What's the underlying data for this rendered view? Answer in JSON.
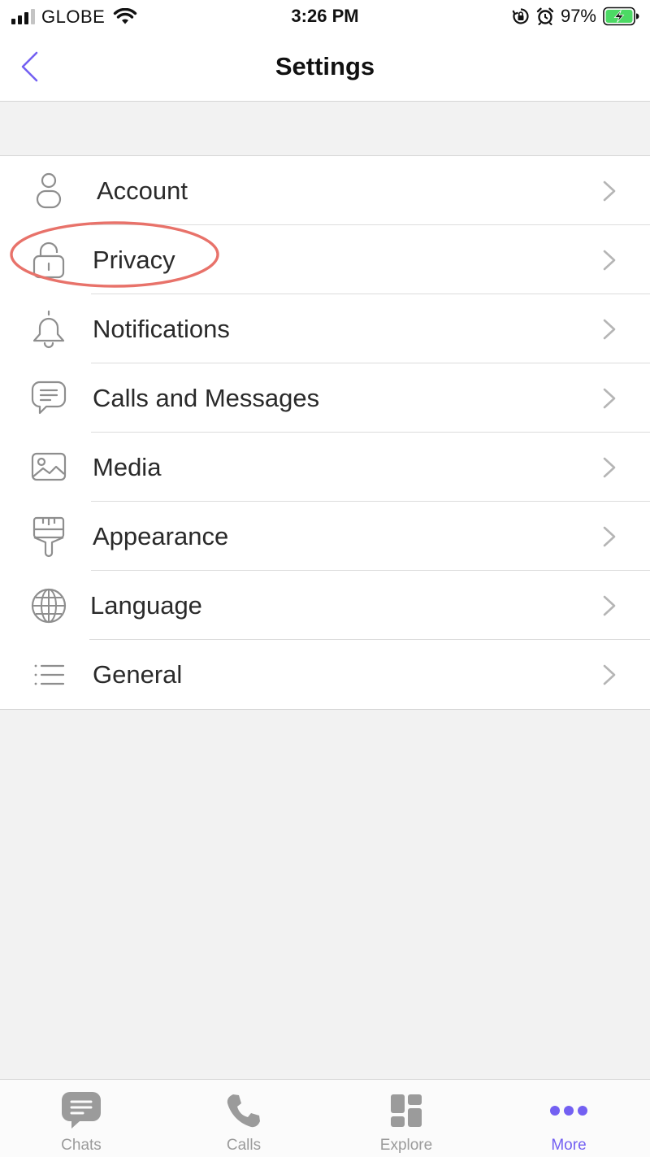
{
  "status_bar": {
    "carrier": "GLOBE",
    "time": "3:26 PM",
    "battery_percent": "97%",
    "signal_bars_active": 3,
    "signal_bars_total": 4
  },
  "nav": {
    "title": "Settings",
    "back_icon": "chevron-left-icon"
  },
  "settings": {
    "items": [
      {
        "label": "Account",
        "icon": "person-icon"
      },
      {
        "label": "Privacy",
        "icon": "lock-icon",
        "highlighted": true
      },
      {
        "label": "Notifications",
        "icon": "bell-icon"
      },
      {
        "label": "Calls and Messages",
        "icon": "chat-bubble-icon"
      },
      {
        "label": "Media",
        "icon": "image-icon"
      },
      {
        "label": "Appearance",
        "icon": "paintbrush-icon"
      },
      {
        "label": "Language",
        "icon": "globe-icon"
      },
      {
        "label": "General",
        "icon": "list-icon"
      }
    ]
  },
  "tab_bar": {
    "tabs": [
      {
        "label": "Chats",
        "icon": "chat-icon",
        "active": false
      },
      {
        "label": "Calls",
        "icon": "phone-icon",
        "active": false
      },
      {
        "label": "Explore",
        "icon": "grid-icon",
        "active": false
      },
      {
        "label": "More",
        "icon": "more-dots-icon",
        "active": true
      }
    ]
  },
  "colors": {
    "accent": "#7360f2",
    "highlight_ring": "#e8726a",
    "battery_charging": "#4cd964",
    "inactive_tab": "#9b9b9b",
    "icon_gray": "#8e8e8e"
  }
}
